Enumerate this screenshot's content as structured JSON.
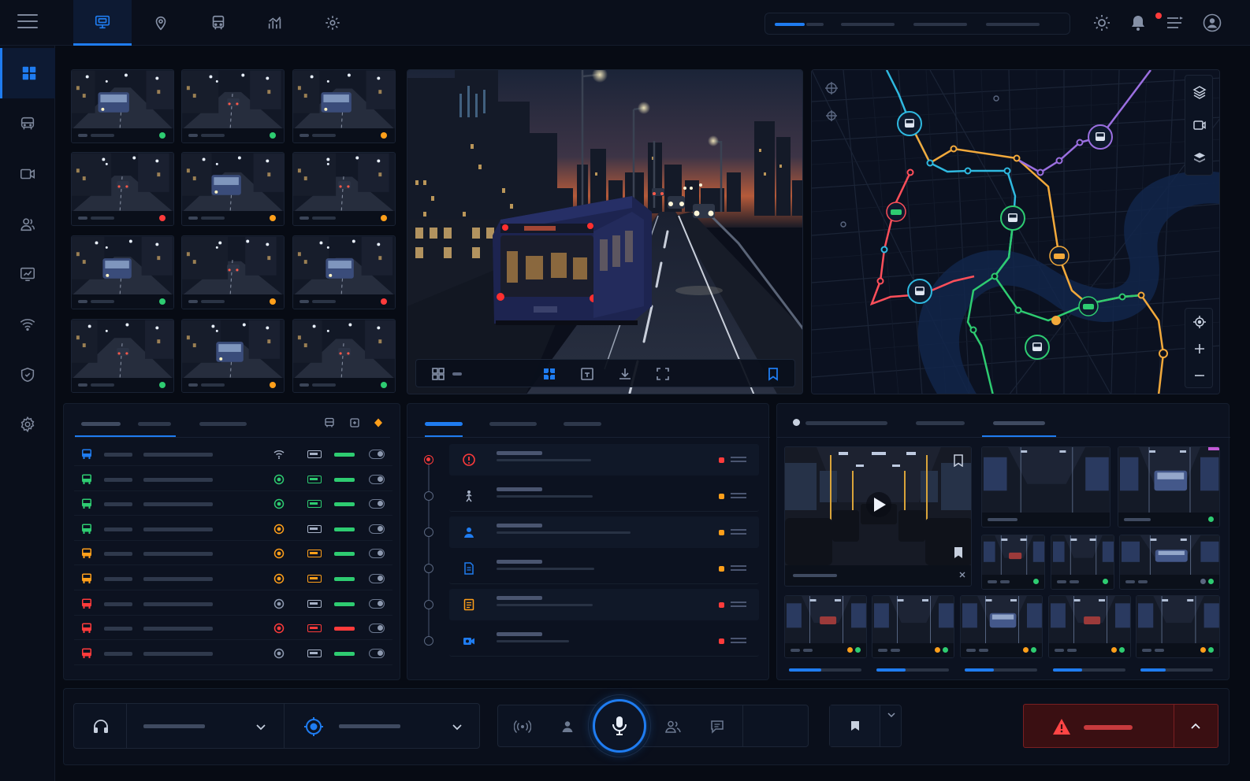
{
  "colors": {
    "accent": "#1f7cf0",
    "ok": "#2ecc71",
    "warn": "#ff9f1a",
    "alert": "#ff3b3b",
    "panel": "#0c1220"
  },
  "topbar": {
    "menu_icon": "hamburger-icon",
    "tabs": [
      {
        "icon": "monitor-icon",
        "active": true
      },
      {
        "icon": "location-pin-icon",
        "active": false
      },
      {
        "icon": "bus-icon",
        "active": false
      },
      {
        "icon": "analytics-icon",
        "active": false
      },
      {
        "icon": "gear-icon",
        "active": false
      }
    ],
    "right_icons": [
      "brightness-icon",
      "bell-icon",
      "list-icon",
      "user-icon"
    ]
  },
  "sidebar": {
    "items": [
      {
        "icon": "dashboard-grid-icon",
        "active": true
      },
      {
        "icon": "bus-icon",
        "active": false
      },
      {
        "icon": "video-camera-icon",
        "active": false
      },
      {
        "icon": "users-icon",
        "active": false
      },
      {
        "icon": "monitor-chart-icon",
        "active": false
      },
      {
        "icon": "wifi-icon",
        "active": false
      },
      {
        "icon": "shield-icon",
        "active": false
      },
      {
        "icon": "gear-icon",
        "active": false
      }
    ]
  },
  "camera_grid": {
    "thumbnails": [
      {
        "status": "green"
      },
      {
        "status": "green"
      },
      {
        "status": "orange"
      },
      {
        "status": "red"
      },
      {
        "status": "orange"
      },
      {
        "status": "orange"
      },
      {
        "status": "green"
      },
      {
        "status": "orange"
      },
      {
        "status": "red"
      },
      {
        "status": "green"
      },
      {
        "status": "orange"
      },
      {
        "status": "green"
      }
    ]
  },
  "fleet_list": {
    "rows": [
      {
        "color": "#1f7cf0",
        "signal": "wifi",
        "signal_color": "#a7b2c7",
        "battery": "#a7b2c7",
        "level": "#2ecc71"
      },
      {
        "color": "#2ecc71",
        "signal": "ring",
        "signal_color": "#2ecc71",
        "battery": "#2ecc71",
        "level": "#2ecc71"
      },
      {
        "color": "#2ecc71",
        "signal": "ring",
        "signal_color": "#2ecc71",
        "battery": "#2ecc71",
        "level": "#2ecc71"
      },
      {
        "color": "#2ecc71",
        "signal": "ring",
        "signal_color": "#ff9f1a",
        "battery": "#a7b2c7",
        "level": "#2ecc71"
      },
      {
        "color": "#ff9f1a",
        "signal": "ring",
        "signal_color": "#ff9f1a",
        "battery": "#ff9f1a",
        "level": "#2ecc71"
      },
      {
        "color": "#ff9f1a",
        "signal": "ring",
        "signal_color": "#ff9f1a",
        "battery": "#ff9f1a",
        "level": "#2ecc71"
      },
      {
        "color": "#ff3b3b",
        "signal": "ring",
        "signal_color": "#8e9ab0",
        "battery": "#a7b2c7",
        "level": "#2ecc71"
      },
      {
        "color": "#ff3b3b",
        "signal": "ring",
        "signal_color": "#ff3b3b",
        "battery": "#ff3b3b",
        "level": "#ff3b3b"
      },
      {
        "color": "#ff3b3b",
        "signal": "ring",
        "signal_color": "#8e9ab0",
        "battery": "#a7b2c7",
        "level": "#2ecc71"
      }
    ]
  },
  "events": {
    "items": [
      {
        "icon": "alert-circle-icon",
        "icon_color": "#ff3b3b",
        "severity": "#ff3b3b"
      },
      {
        "icon": "person-walk-icon",
        "icon_color": "#a7b2c7",
        "severity": "#ff9f1a"
      },
      {
        "icon": "person-icon",
        "icon_color": "#1f7cf0",
        "severity": "#ff9f1a"
      },
      {
        "icon": "document-icon",
        "icon_color": "#1f7cf0",
        "severity": "#ff9f1a"
      },
      {
        "icon": "report-icon",
        "icon_color": "#ff9f1a",
        "severity": "#ff3b3b"
      },
      {
        "icon": "camera-icon",
        "icon_color": "#1f7cf0",
        "severity": "#ff3b3b"
      }
    ]
  },
  "recordings": {
    "progress": [
      0.45,
      0.4,
      0.4,
      0.4,
      0.35
    ]
  },
  "bottom_bar": {
    "headset_icon": "headset-icon",
    "target_icon": "target-icon",
    "mic_icon": "microphone-icon",
    "alarm_icon": "warning-triangle-icon"
  }
}
